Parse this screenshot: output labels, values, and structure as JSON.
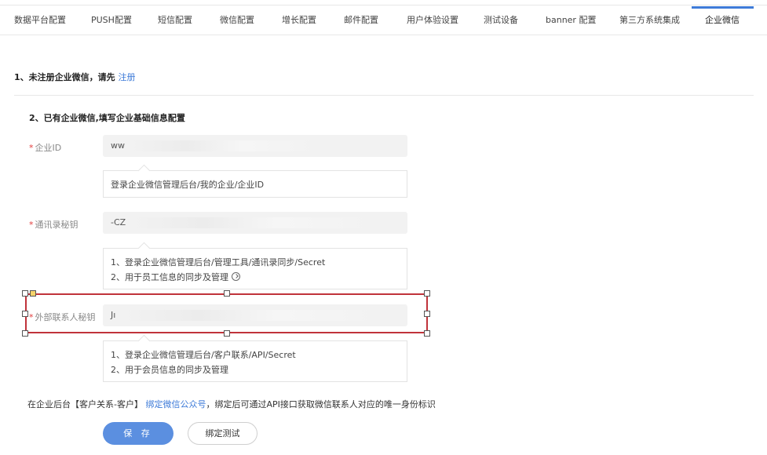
{
  "tabs": [
    {
      "label": "数据平台配置"
    },
    {
      "label": "PUSH配置"
    },
    {
      "label": "短信配置"
    },
    {
      "label": "微信配置"
    },
    {
      "label": "增长配置"
    },
    {
      "label": "邮件配置"
    },
    {
      "label": "用户体验设置"
    },
    {
      "label": "测试设备"
    },
    {
      "label": "banner 配置"
    },
    {
      "label": "第三方系统集成"
    },
    {
      "label": "企业微信"
    }
  ],
  "active_tab": "企业微信",
  "section1": {
    "text": "1、未注册企业微信，请先",
    "link": "注册"
  },
  "section2": {
    "title": "2、已有企业微信,填写企业基础信息配置"
  },
  "fields": {
    "required_mark": "*",
    "corp_id": {
      "label": "企业ID",
      "value": "ww",
      "tip": "登录企业微信管理后台/我的企业/企业ID"
    },
    "contacts_secret": {
      "label": "通讯录秘钥",
      "value": "-CZ",
      "tip_line1": "1、登录企业微信管理后台/管理工具/通讯录同步/Secret",
      "tip_line2": "2、用于员工信息的同步及管理"
    },
    "external_secret": {
      "label": "外部联系人秘钥",
      "value": "Jı",
      "tip_line1": "1、登录企业微信管理后台/客户联系/API/Secret",
      "tip_line2": "2、用于会员信息的同步及管理"
    }
  },
  "bind": {
    "prefix": "在企业后台【客户关系-客户】",
    "link": "绑定微信公众号",
    "suffix": "，绑定后可通过API接口获取微信联系人对应的唯一身份标识"
  },
  "buttons": {
    "save": "保 存",
    "test": "绑定测试"
  },
  "colors": {
    "accent": "#3e7bd8",
    "required": "#e23b3b",
    "selection": "#c0333b"
  }
}
